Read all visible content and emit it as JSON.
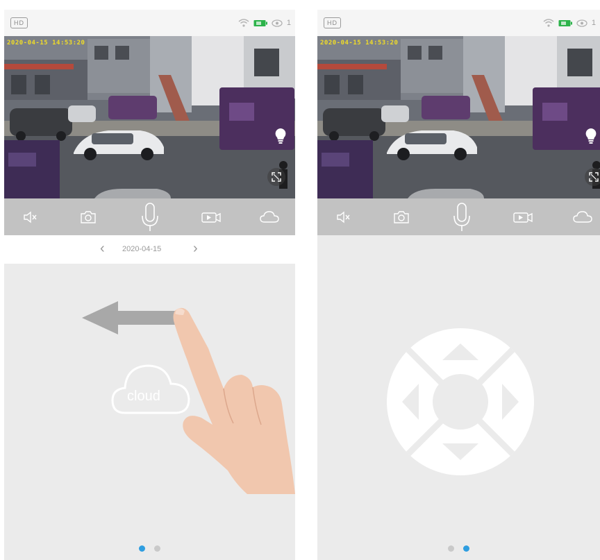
{
  "colors": {
    "accent": "#2f9ee0",
    "battery": "#2cb34a",
    "timestamp": "#f0dc28",
    "control_bar": "#c2c2c2",
    "page_bg": "#ebebeb"
  },
  "screens": [
    {
      "status": {
        "quality_badge": "HD",
        "viewer_count": "1",
        "icons": [
          "wifi-icon",
          "battery-icon",
          "eye-icon"
        ]
      },
      "video": {
        "timestamp": "2020-04-15 14:53:20"
      },
      "controls": [
        "mute-icon",
        "camera-icon",
        "microphone-icon",
        "record-video-icon",
        "cloud-icon"
      ],
      "date_nav": {
        "date": "2020-04-15",
        "prev_icon": "chevron-left-icon",
        "next_icon": "chevron-right-icon"
      },
      "content": {
        "cloud_label": "cloud",
        "gesture": "swipe-left"
      },
      "pager": {
        "count": 2,
        "active": 0
      }
    },
    {
      "status": {
        "quality_badge": "HD",
        "viewer_count": "1",
        "icons": [
          "wifi-icon",
          "battery-icon",
          "eye-icon"
        ]
      },
      "video": {
        "timestamp": "2020-04-15 14:53:20"
      },
      "controls": [
        "mute-icon",
        "camera-icon",
        "microphone-icon",
        "record-video-icon",
        "cloud-icon"
      ],
      "content": {
        "widget": "ptz-direction-pad"
      },
      "pager": {
        "count": 2,
        "active": 1
      }
    }
  ]
}
